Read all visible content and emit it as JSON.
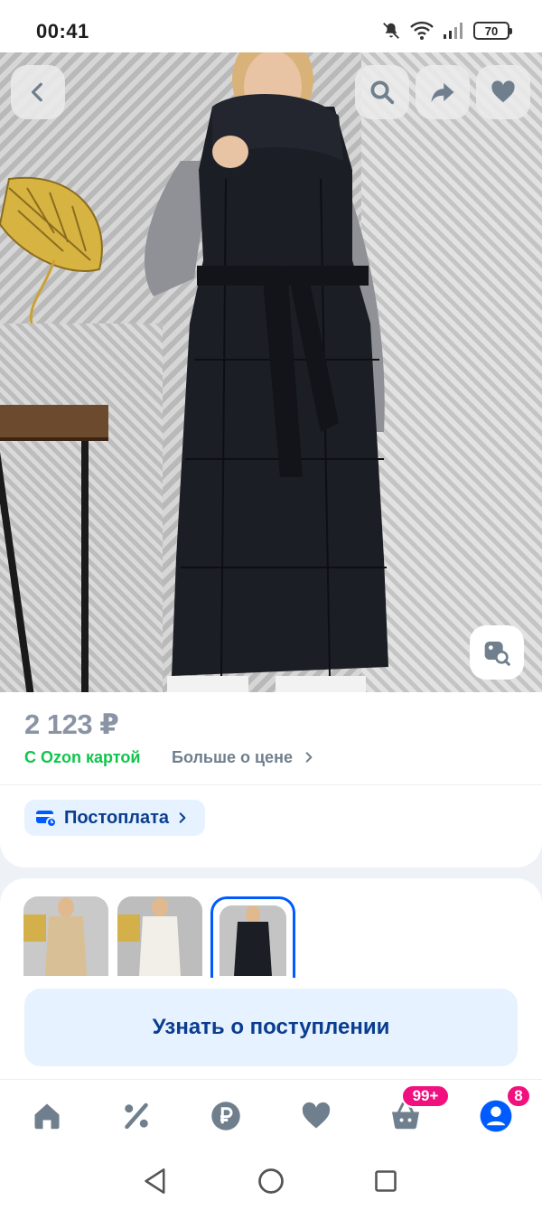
{
  "status_bar": {
    "time": "00:41",
    "battery": "70"
  },
  "product": {
    "price": "2 123 ₽",
    "ozon_card_label": "С Ozon картой",
    "more_price_label": "Больше о цене",
    "postpay_label": "Постоплата"
  },
  "actions": {
    "notify_label": "Узнать о поступлении"
  },
  "bottom_nav": {
    "cart_badge": "99+",
    "profile_badge": "8"
  },
  "icons": {
    "back": "chevron-left-icon",
    "search": "search-icon",
    "share": "share-arrow-icon",
    "favorite": "heart-icon",
    "visual_search": "image-search-icon",
    "home": "home-icon",
    "promo": "percent-icon",
    "finance": "ruble-icon",
    "cart": "cart-icon",
    "profile": "profile-icon"
  },
  "colors": {
    "brand_blue": "#005bff",
    "chip_bg": "#e6f2ff",
    "chip_text": "#0a3d8f",
    "green": "#10c44c",
    "badge_pink": "#f1117e",
    "price_gray": "#8a94a4"
  }
}
